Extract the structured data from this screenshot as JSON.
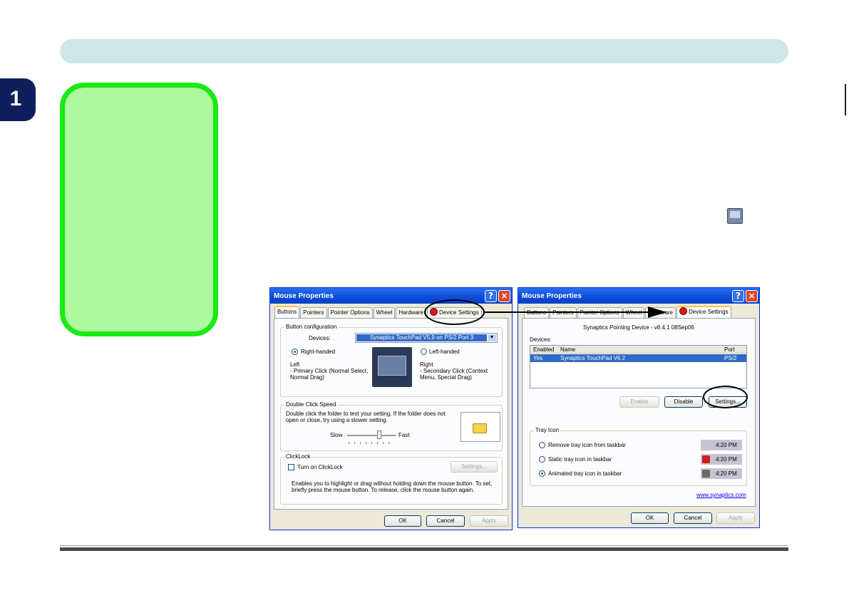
{
  "page": {
    "chapter_number": "1"
  },
  "left_window": {
    "title": "Mouse Properties",
    "help_button": "?",
    "close_button": "×",
    "tabs": [
      "Buttons",
      "Pointers",
      "Pointer Options",
      "Wheel",
      "Hardware",
      "Device Settings"
    ],
    "button_config": {
      "group_label": "Button configuration",
      "devices_label": "Devices:",
      "devices_value": "Synaptics TouchPad V5.9 on PS/2 Port 3",
      "right_handed": "Right-handed",
      "left_handed": "Left-handed",
      "left_title": "Left",
      "left_desc1": "- Primary Click (Normal Select,",
      "left_desc2": "Normal Drag)",
      "right_title": "Right",
      "right_desc1": "- Secondary Click (Context",
      "right_desc2": "Menu, Special Drag)"
    },
    "double_click": {
      "group_label": "Double Click Speed",
      "desc1": "Double click the folder to test your setting.  If the folder does not",
      "desc2": "open or close, try using a slower setting.",
      "slow": "Slow",
      "fast": "Fast"
    },
    "clicklock": {
      "group_label": "ClickLock",
      "checkbox_label": "Turn on ClickLock",
      "settings_button": "Settings...",
      "desc1": "Enables you to highlight or drag without holding down the mouse button.  To set,",
      "desc2": "briefly press the mouse button.  To release, click the mouse button again."
    },
    "footer": {
      "ok": "OK",
      "cancel": "Cancel",
      "apply": "Apply"
    }
  },
  "right_window": {
    "title": "Mouse Properties",
    "help_button": "?",
    "close_button": "×",
    "tabs": [
      "Buttons",
      "Pointers",
      "Pointer Options",
      "Wheel",
      "Hardware",
      "Device Settings"
    ],
    "version": "Synaptics Pointing Device - v8.4.1 08Sep06",
    "devices_label": "Devices:",
    "table": {
      "headers": [
        "Enabled",
        "Name",
        "Port"
      ],
      "rows": [
        [
          "Yes",
          "Synaptics TouchPad V6.2",
          "PS/2"
        ]
      ]
    },
    "buttons": {
      "enable": "Enable",
      "disable": "Disable",
      "settings": "Settings..."
    },
    "tray": {
      "group_label": "Tray Icon",
      "options": [
        {
          "label": "Remove tray icon from taskbar",
          "time": "4:20 PM",
          "selected": false
        },
        {
          "label": "Static tray icon in taskbar",
          "time": "4:20 PM",
          "selected": false
        },
        {
          "label": "Animated tray icon in taskbar",
          "time": "4:20 PM",
          "selected": true
        }
      ]
    },
    "link": "www.synaptics.com",
    "footer": {
      "ok": "OK",
      "cancel": "Cancel",
      "apply": "Apply"
    }
  }
}
